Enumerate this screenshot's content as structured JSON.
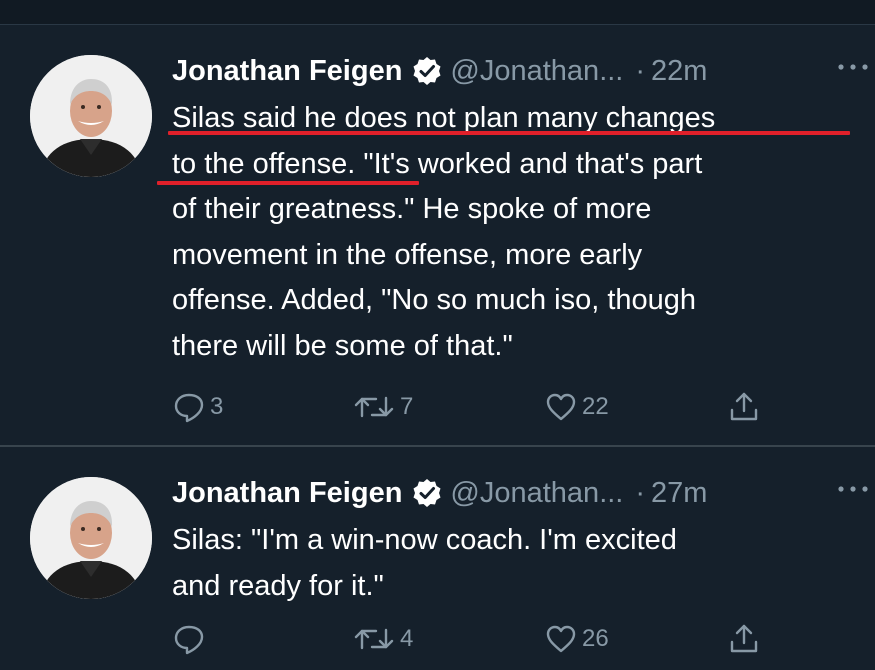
{
  "tweets": [
    {
      "author_name": "Jonathan Feigen",
      "handle": "@Jonathan...",
      "separator": "·",
      "time": "22m",
      "text_lines": [
        "Silas said he does not plan many changes",
        "to the offense. \"It's worked and that's part",
        "of their greatness.\" He spoke of more",
        "movement in the offense, more early",
        "offense. Added, \"No so much iso, though",
        "there will be some of that.\""
      ],
      "reply_count": "3",
      "retweet_count": "7",
      "like_count": "22"
    },
    {
      "author_name": "Jonathan Feigen",
      "handle": "@Jonathan...",
      "separator": "·",
      "time": "27m",
      "text_lines": [
        "Silas: \"I'm a win-now coach. I'm excited",
        "and ready for it.\""
      ],
      "reply_count": "",
      "retweet_count": "4",
      "like_count": "26"
    }
  ],
  "icons": {
    "verified": "verified-badge-icon",
    "more": "more-dots-icon",
    "reply": "reply-icon",
    "retweet": "retweet-icon",
    "like": "heart-icon",
    "share": "share-icon"
  },
  "colors": {
    "background": "#15202b",
    "secondary_text": "#8899a6",
    "highlight_underline": "#e0202a",
    "divider": "#38444d"
  }
}
